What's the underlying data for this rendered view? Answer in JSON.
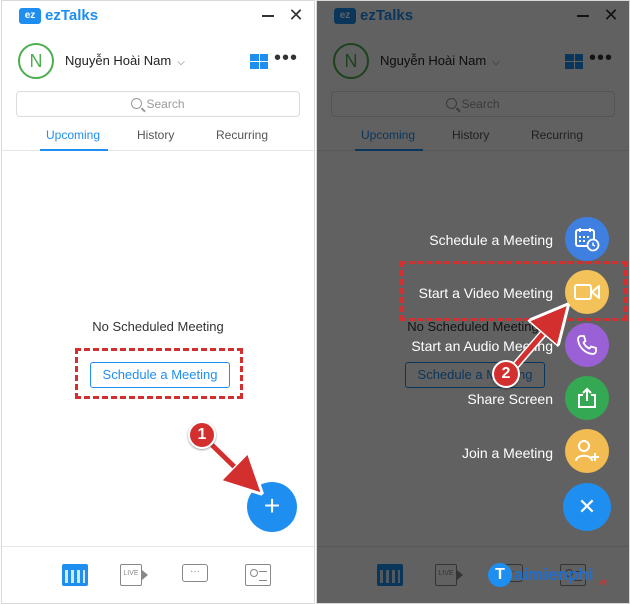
{
  "app": {
    "logo_badge": "ez",
    "logo_text": "ezTalks",
    "close_glyph": "✕",
    "accent_color": "#1f8ef1"
  },
  "user": {
    "initial": "N",
    "name": "Nguyễn Hoài Nam",
    "caret": "⌵"
  },
  "search": {
    "placeholder": "Search"
  },
  "tabs": [
    {
      "label": "Upcoming",
      "active": true
    },
    {
      "label": "History",
      "active": false
    },
    {
      "label": "Recurring",
      "active": false
    }
  ],
  "main": {
    "empty_text": "No Scheduled Meeting",
    "schedule_button": "Schedule a Meeting",
    "fab_glyph": "+"
  },
  "bottom_nav": [
    {
      "icon": "calendar-icon",
      "active": true
    },
    {
      "icon": "live-video-icon",
      "label": "LIVE",
      "active": false
    },
    {
      "icon": "chat-icon",
      "label": "···",
      "active": false
    },
    {
      "icon": "contacts-icon",
      "active": false
    }
  ],
  "fab_menu": [
    {
      "label": "Schedule a Meeting",
      "icon": "calendar-clock-icon",
      "color": "#3f7fe0"
    },
    {
      "label": "Start a Video Meeting",
      "icon": "video-camera-icon",
      "color": "#f3c35a"
    },
    {
      "label": "Start an Audio Meeting",
      "icon": "phone-icon",
      "color": "#9a60d6"
    },
    {
      "label": "Share Screen",
      "icon": "share-screen-icon",
      "color": "#35a853"
    },
    {
      "label": "Join a Meeting",
      "icon": "add-user-icon",
      "color": "#f2bc52"
    }
  ],
  "fab_close_glyph": "✕",
  "steps": {
    "one": "1",
    "two": "2"
  },
  "annotation_color": "#d32f2f"
}
